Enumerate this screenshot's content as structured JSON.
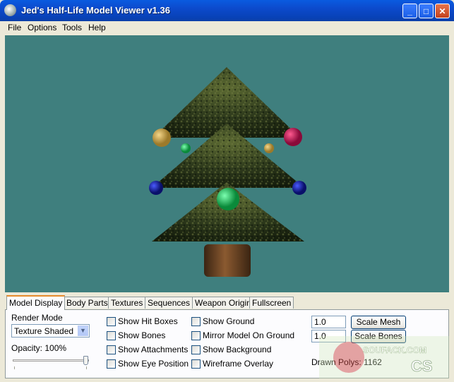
{
  "window": {
    "title": "Jed's Half-Life Model Viewer v1.36",
    "buttons": {
      "minimize": "_",
      "maximize": "□",
      "close": "✕"
    }
  },
  "menu": [
    "File",
    "Options",
    "Tools",
    "Help"
  ],
  "viewport": {
    "background_color": "#3F7F7E"
  },
  "tabs": [
    "Model Display",
    "Body Parts",
    "Textures",
    "Sequences",
    "Weapon Origin",
    "Fullscreen"
  ],
  "active_tab": "Model Display",
  "panel": {
    "render_mode_label": "Render Mode",
    "render_mode_value": "Texture Shaded",
    "opacity_label": "Opacity: 100%",
    "opacity_value": 1.0,
    "checkboxes_col1": [
      "Show Hit Boxes",
      "Show Bones",
      "Show Attachments",
      "Show Eye Position"
    ],
    "checkboxes_col2": [
      "Show Ground",
      "Mirror Model On Ground",
      "Show Background",
      "Wireframe Overlay"
    ],
    "scale_mesh_value": "1.0",
    "scale_mesh_button": "Scale Mesh",
    "scale_bones_value": "1.0",
    "scale_bones_button": "Scale Bones",
    "drawn_polys": "Drawn Polys: 1162"
  },
  "watermark": {
    "line1": "SOUFACK.COM",
    "line2": "CS"
  }
}
